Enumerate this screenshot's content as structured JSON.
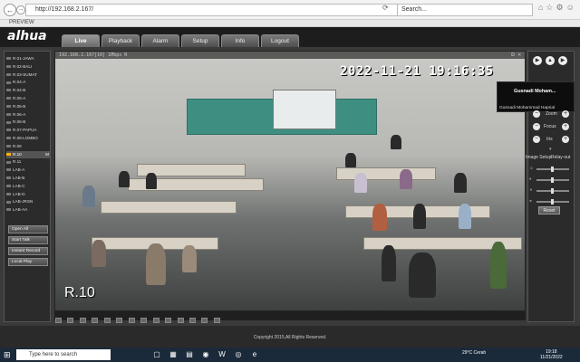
{
  "browser": {
    "address": "http://192.168.2.167/",
    "search_placeholder": "Search...",
    "tab_title": "PREVIEW"
  },
  "header": {
    "logo": "alhua",
    "tabs": [
      "Live",
      "Playback",
      "Alarm",
      "Setup",
      "Info",
      "Logout"
    ]
  },
  "cameras": [
    "R.01-JAWA",
    "R.02-BALI",
    "R.03-SUMAT",
    "R.04-A",
    "R.04-B",
    "R.05-A",
    "R.05-B",
    "R.06-A",
    "R.06-B",
    "R.07-PAPUA",
    "R.08-LOMBO",
    "R.09",
    "R.10",
    "R.11",
    "LAB-A",
    "LAB-B",
    "LAB-C",
    "LAB-D",
    "LAB-JRSN",
    "LAB-AA"
  ],
  "selected_camera_marker": "M",
  "left_buttons": [
    "Open All",
    "Start Talk",
    "Instant Record",
    "Local Play"
  ],
  "video": {
    "osd_info": "192.168.2.167[10] 1Mbps R",
    "timestamp": "2022-11-21  19:16:35",
    "camera_label": "R.10"
  },
  "popup": {
    "name_short": "Gusnadi Moham...",
    "name_full": "Gusnadi Mohammad Haprial"
  },
  "right_panel": {
    "zoom_label": "Zoom",
    "focus_label": "Focus",
    "iris_label": "Iris",
    "image_setup_label": "Image Setup",
    "relay_out_label": "Relay-out",
    "reset_label": "Reset"
  },
  "footer": {
    "copyright": "Copyright 2015,All Rights Reserved."
  },
  "taskbar": {
    "search_placeholder": "Type here to search",
    "weather": "29°C  Cerah",
    "time": "19:18",
    "date": "11/21/2022"
  }
}
